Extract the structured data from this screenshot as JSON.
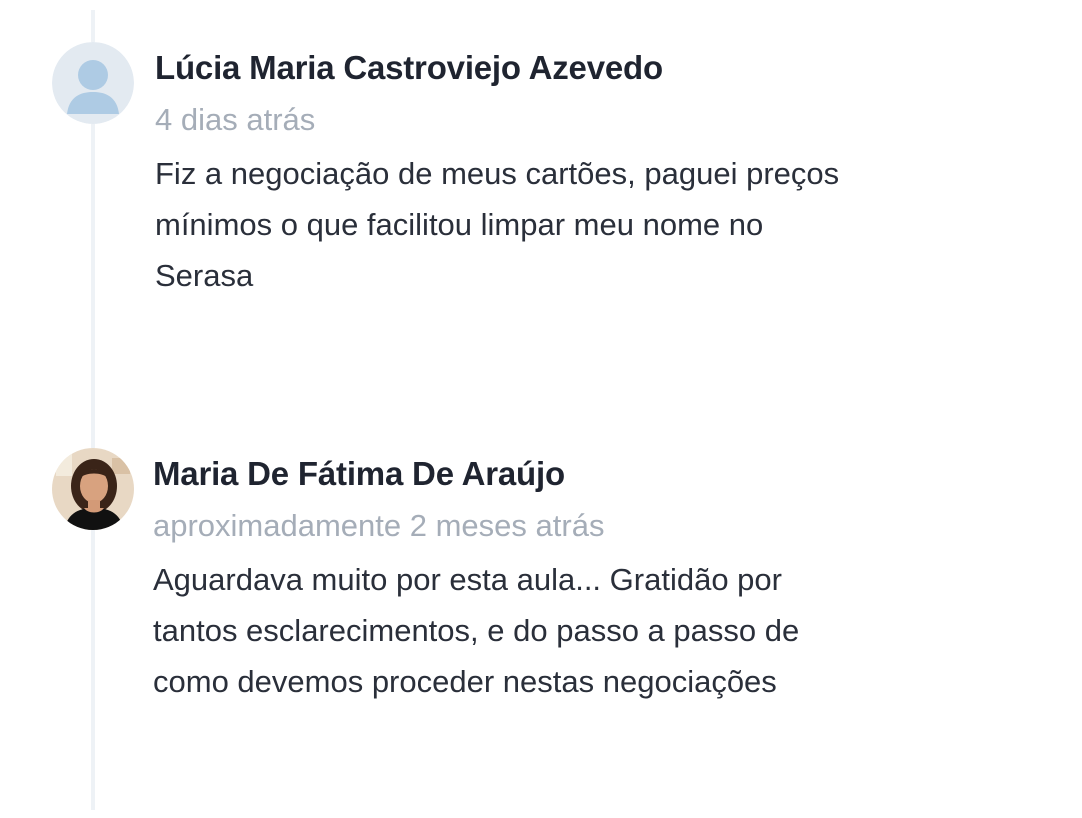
{
  "comments": [
    {
      "author": "Lúcia Maria Castroviejo Azevedo",
      "time": "4 dias atrás",
      "text_lines": [
        "Fiz a negociação de meus cartões, paguei preços",
        "mínimos o que facilitou limpar meu nome no",
        "Serasa"
      ],
      "avatar_icon": "default-user-avatar-icon"
    },
    {
      "author": "Maria De Fátima De Araújo",
      "time": "aproximadamente 2 meses atrás",
      "text_lines": [
        "Aguardava muito por esta aula... Gratidão por",
        "tantos esclarecimentos, e do passo a passo de",
        "como devemos proceder nestas negociações"
      ],
      "avatar_icon": "user-photo-avatar"
    }
  ],
  "colors": {
    "name": "#1f2430",
    "timestamp": "#a5adb8",
    "text": "#2a2f3a",
    "timeline": "#eef2f6",
    "default_avatar_bg": "#dfe7ef",
    "default_avatar_fg": "#a9c8e2"
  }
}
